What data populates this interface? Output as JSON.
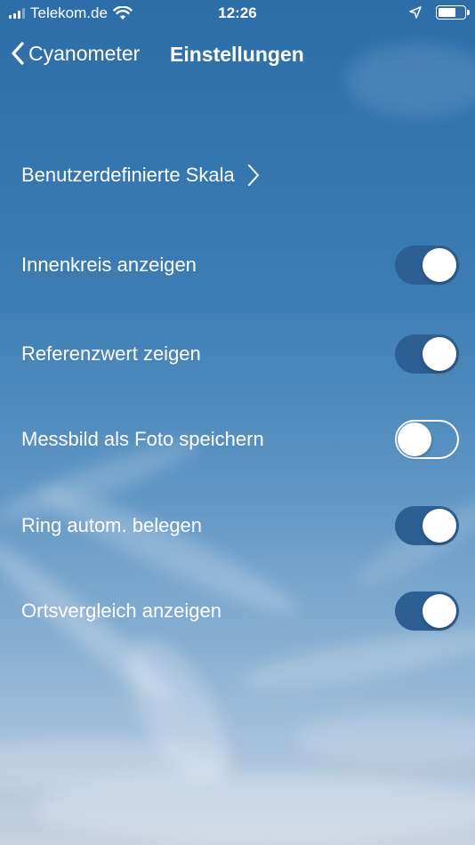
{
  "status_bar": {
    "carrier": "Telekom.de",
    "time": "12:26",
    "battery_level": 0.65,
    "icons": [
      "signal-icon",
      "wifi-icon",
      "location-arrow-icon",
      "battery-icon"
    ]
  },
  "nav": {
    "back_label": "Cyanometer",
    "title": "Einstellungen"
  },
  "settings": {
    "custom_scale": "Benutzerdefinierte Skala",
    "items": [
      {
        "label": "Innenkreis anzeigen",
        "on": true
      },
      {
        "label": "Referenzwert zeigen",
        "on": true
      },
      {
        "label": "Messbild als Foto speichern",
        "on": false
      },
      {
        "label": "Ring autom. belegen",
        "on": true
      },
      {
        "label": "Ortsvergleich anzeigen",
        "on": true
      }
    ]
  },
  "colors": {
    "toggle_on": "#2e5f92",
    "sky_top": "#2d6ea8",
    "sky_bottom": "#c7d1de"
  }
}
